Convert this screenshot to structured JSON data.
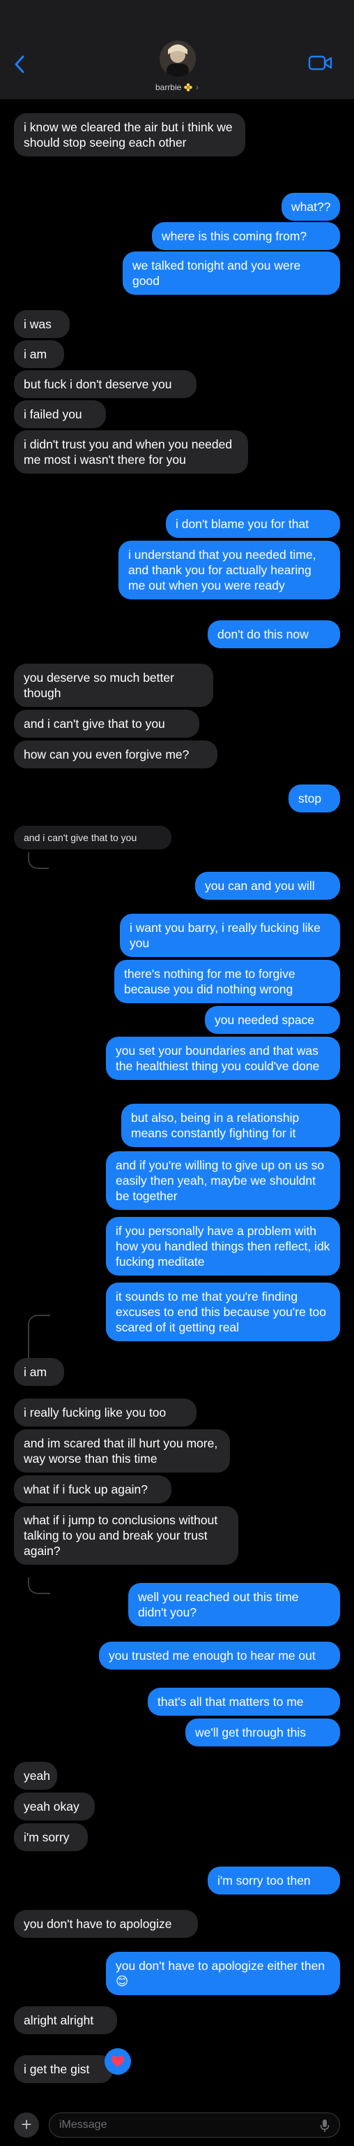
{
  "header": {
    "contact_name": "barrbie",
    "flower_emoji": "🌼",
    "chevron": "›"
  },
  "messages": [
    {
      "id": "m1",
      "from": "them",
      "text": "i know we cleared the air but i think we should stop seeing each other"
    },
    {
      "id": "m2",
      "from": "me",
      "text": "what??"
    },
    {
      "id": "m3",
      "from": "me",
      "text": "where is this coming from?"
    },
    {
      "id": "m4",
      "from": "me",
      "text": "we talked tonight and you were good"
    },
    {
      "id": "m5",
      "from": "them",
      "text": "i was"
    },
    {
      "id": "m6",
      "from": "them",
      "text": "i am"
    },
    {
      "id": "m7",
      "from": "them",
      "text": "but fuck i don't deserve you"
    },
    {
      "id": "m8",
      "from": "them",
      "text": "i failed you"
    },
    {
      "id": "m9",
      "from": "them",
      "text": "i didn't trust you and when you needed me most i wasn't there for you"
    },
    {
      "id": "m10",
      "from": "me",
      "text": "i don't blame you for that"
    },
    {
      "id": "m11",
      "from": "me",
      "text": "i understand that you needed time, and thank you for actually hearing me out when you were ready"
    },
    {
      "id": "m12",
      "from": "me",
      "text": "don't do this now"
    },
    {
      "id": "m13",
      "from": "them",
      "text": "you deserve so much better though"
    },
    {
      "id": "m14",
      "from": "them",
      "text": "and i can't give that to you"
    },
    {
      "id": "m15",
      "from": "them",
      "text": "how can you even forgive me?"
    },
    {
      "id": "m16",
      "from": "me",
      "text": "stop"
    },
    {
      "id": "m17",
      "from": "quote",
      "text": "and i can't give that to you"
    },
    {
      "id": "m18",
      "from": "me",
      "text": "you can and you will"
    },
    {
      "id": "m19",
      "from": "me",
      "text": "i want you barry, i really fucking like you"
    },
    {
      "id": "m20",
      "from": "me",
      "text": "there's nothing for me to forgive because you did nothing wrong"
    },
    {
      "id": "m21",
      "from": "me",
      "text": "you needed space"
    },
    {
      "id": "m22",
      "from": "me",
      "text": "you set your boundaries and that was the healthiest thing you could've done"
    },
    {
      "id": "m23",
      "from": "me",
      "text": "but also, being in a relationship means constantly fighting for it"
    },
    {
      "id": "m24",
      "from": "me",
      "text": "and if you're willing to give up on us so easily then yeah, maybe we shouldnt be together"
    },
    {
      "id": "m25",
      "from": "me",
      "text": "if you personally have a problem with how you handled things then reflect, idk fucking meditate"
    },
    {
      "id": "m26",
      "from": "me",
      "text": "it sounds to me that you're finding excuses to end this because you're too scared of it getting real"
    },
    {
      "id": "m27",
      "from": "them",
      "text": "i am"
    },
    {
      "id": "m28",
      "from": "them",
      "text": "i really fucking like you too"
    },
    {
      "id": "m29",
      "from": "them",
      "text": "and im scared that ill hurt you more, way worse than this time"
    },
    {
      "id": "m30",
      "from": "them",
      "text": "what if i fuck up again?"
    },
    {
      "id": "m31",
      "from": "them",
      "text": "what if i jump to conclusions without talking to you and break your trust again?"
    },
    {
      "id": "m32",
      "from": "me",
      "text": "well you reached out this time didn't you?"
    },
    {
      "id": "m33",
      "from": "me",
      "text": "you trusted me enough to hear me out"
    },
    {
      "id": "m34",
      "from": "me",
      "text": "that's all that matters to me"
    },
    {
      "id": "m35",
      "from": "me",
      "text": "we'll get through this"
    },
    {
      "id": "m36",
      "from": "them",
      "text": "yeah"
    },
    {
      "id": "m37",
      "from": "them",
      "text": "yeah okay"
    },
    {
      "id": "m38",
      "from": "them",
      "text": "i'm sorry"
    },
    {
      "id": "m39",
      "from": "me",
      "text": "i'm sorry too then"
    },
    {
      "id": "m40",
      "from": "them",
      "text": "you don't have to apologize"
    },
    {
      "id": "m41",
      "from": "me",
      "text": "you don't have to apologize either then 😊"
    },
    {
      "id": "m42",
      "from": "them",
      "text": "alright alright"
    },
    {
      "id": "m43",
      "from": "them",
      "text": "i get the gist"
    }
  ],
  "composer": {
    "placeholder": "iMessage",
    "plus_label": "+"
  },
  "icons": {
    "back": "chevron-left-icon",
    "video": "video-camera-icon",
    "mic": "microphone-icon",
    "tapback": "heart-icon"
  },
  "colors": {
    "outgoing": "#1b80f8",
    "incoming": "#262628",
    "header": "#1c1c1e"
  }
}
